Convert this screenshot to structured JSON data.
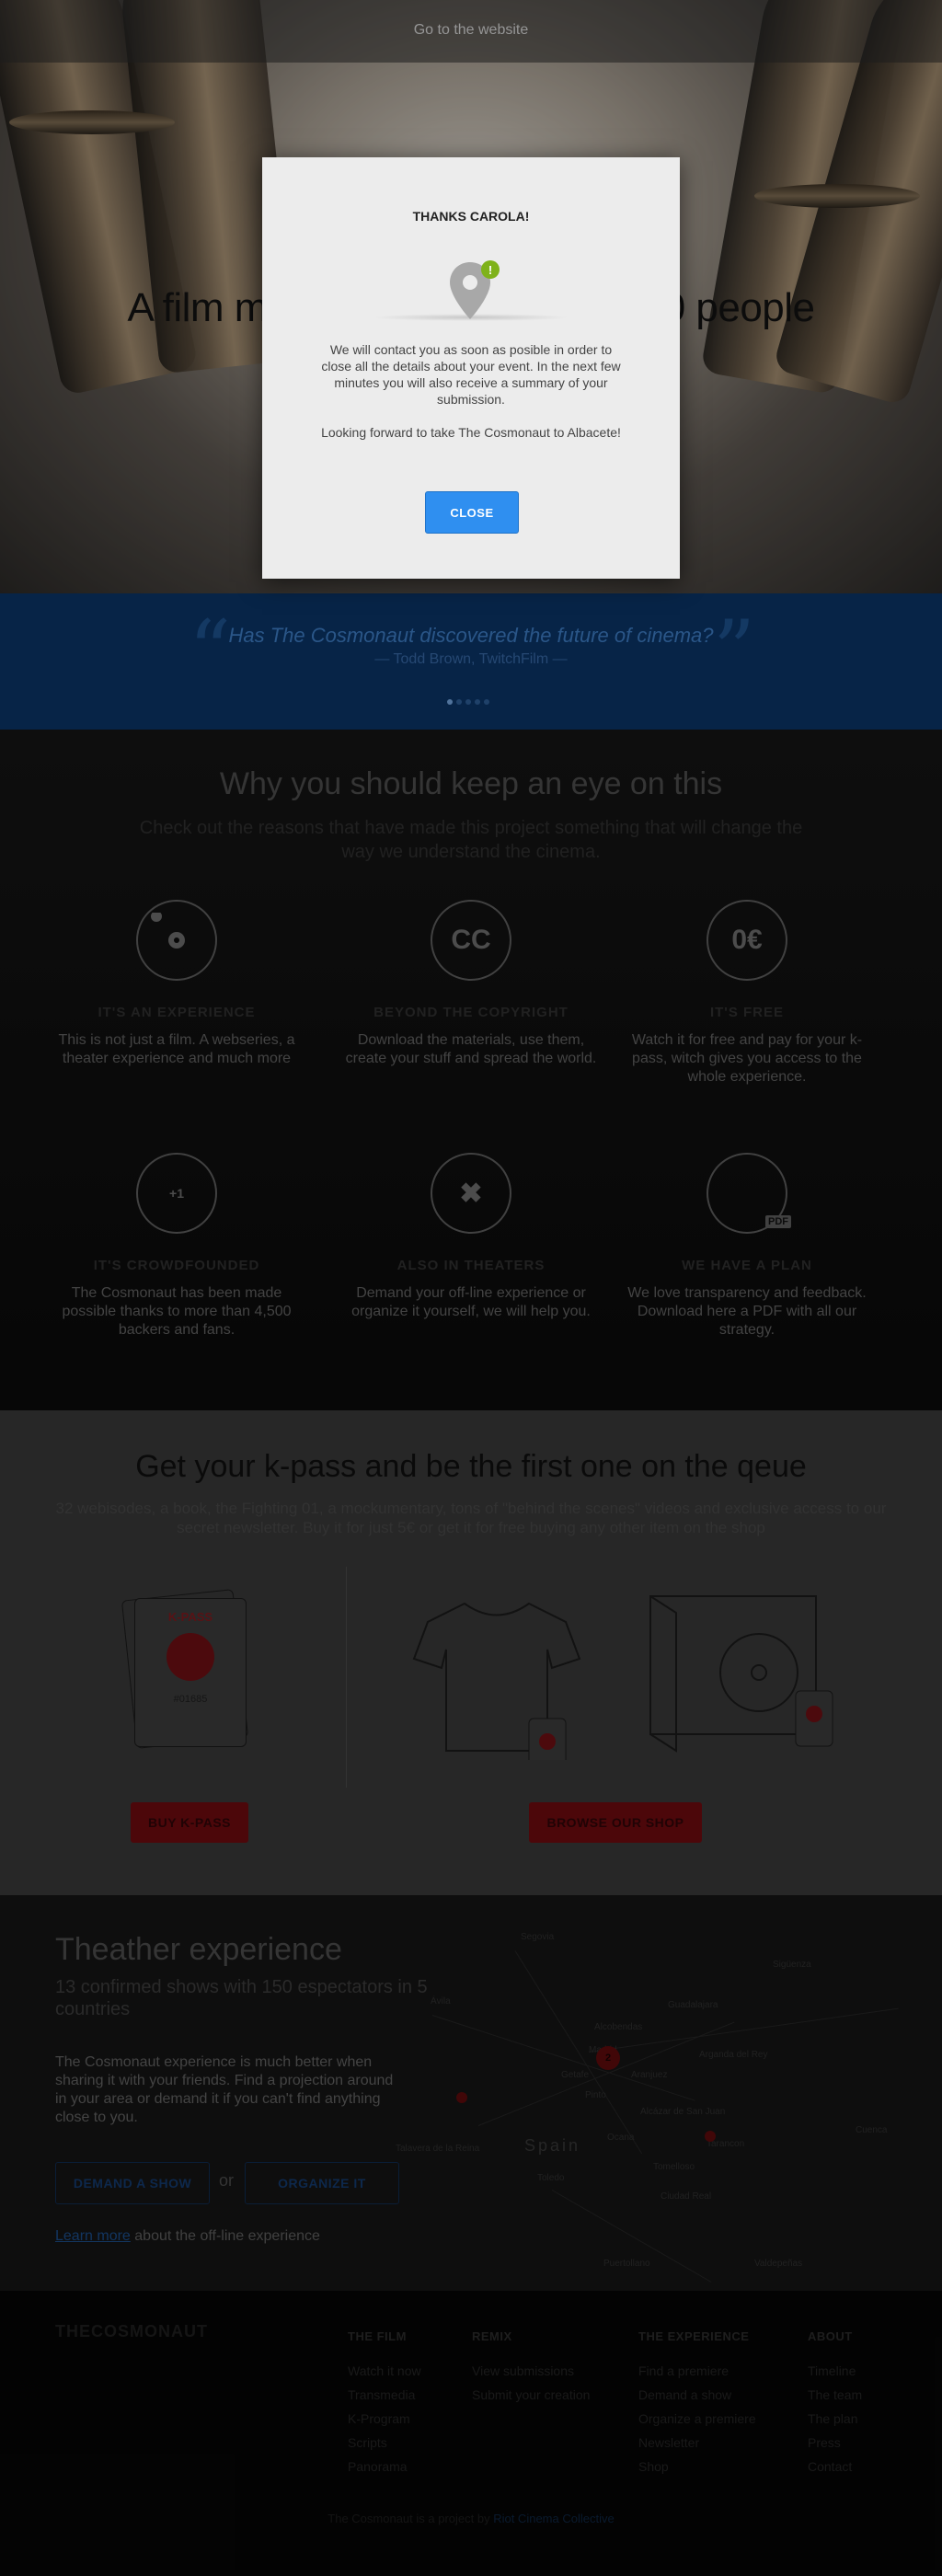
{
  "topbar": {
    "link": "Go to the website"
  },
  "hero": {
    "title": "A film made by more than 4,500 people"
  },
  "quote": {
    "open_mark": "“",
    "close_mark": "”",
    "text": "Has The Cosmonaut discovered the future of cinema?",
    "author": "— Todd Brown, TwitchFilm —",
    "dots_count": 5,
    "active_dot": 1
  },
  "features": {
    "title": "Why you should keep an eye on this",
    "subtitle": "Check out the reasons that have made this project something that will change the way we understand the cinema.",
    "items": [
      {
        "icon": "film-reel-icon",
        "glyph": "◉",
        "title": "IT'S AN EXPERIENCE",
        "desc": "This is not just a film. A webseries, a theater experience and much more"
      },
      {
        "icon": "creative-commons-icon",
        "glyph": "CC",
        "title": "BEYOND THE COPYRIGHT",
        "desc": "Download the materials, use them, create your stuff and spread the world."
      },
      {
        "icon": "zero-euro-icon",
        "glyph": "0€",
        "title": "IT'S FREE",
        "desc": "Watch it for free and pay for your k-pass, witch gives you access to the whole experience."
      },
      {
        "icon": "crowdfunding-bubbles-icon",
        "glyph": "+1",
        "title": "IT'S CROWDFOUNDED",
        "desc": "The Cosmonaut has been made possible thanks to more than 4,500 backers and fans."
      },
      {
        "icon": "spotlights-icon",
        "glyph": "✖",
        "title": "ALSO IN THEATERS",
        "desc": "Demand your off-line experience or organize it yourself, we will help you."
      },
      {
        "icon": "pdf-plan-icon",
        "glyph": "PDF",
        "title": "WE HAVE A PLAN",
        "desc": "We love transparency and feedback. Download here a PDF with all our strategy."
      }
    ]
  },
  "kpass": {
    "title": "Get your k-pass and be the first one on the qeue",
    "subtitle": "32 webisodes, a book, the Fighting 01, a mockumentary, tons of \"behind the scenes\" videos and exclusive access to our secret newsletter. Buy it for just 5€ or get it for free buying any other item on the shop",
    "card_label": "K-PASS",
    "card_number": "#01685",
    "buy_button": "BUY K-PASS",
    "shop_button": "BROWSE OUR SHOP"
  },
  "theater": {
    "title": "Theather experience",
    "stats": "13 confirmed shows with 150 espectators in 5 countries",
    "desc": "The Cosmonaut experience is much better when sharing it with your friends. Find a projection around in your area or demand it if you can't find anything close to you.",
    "demand_button": "DEMAND A SHOW",
    "or": "or",
    "organize_button": "ORGANIZE IT",
    "learn_link": "Learn more",
    "learn_rest": " about the off-line experience",
    "map": {
      "country": "Spain",
      "cities": [
        "Segovia",
        "Ávila",
        "Guadalajara",
        "Madrid",
        "Toledo",
        "Cuenca",
        "Talavera de la Reina",
        "Alcobendas",
        "Getafe",
        "Aranjuez",
        "Ciudad Real",
        "Puertollano",
        "Valdepeñas",
        "Tarancon",
        "Tomelloso",
        "Alcázar de San Juan",
        "Sigüenza",
        "Arganda del Rey",
        "Pinto",
        "Ocana"
      ],
      "cluster_count": "2"
    }
  },
  "footer": {
    "brand": "THECOSMONAUT",
    "columns": [
      {
        "heading": "THE FILM",
        "links": [
          "Watch it now",
          "Transmedia",
          "K-Program",
          "Scripts",
          "Panorama"
        ]
      },
      {
        "heading": "REMIX",
        "links": [
          "View submissions",
          "Submit your creation"
        ]
      },
      {
        "heading": "THE EXPERIENCE",
        "links": [
          "Find a premiere",
          "Demand a show",
          "Organize a premiere",
          "Newsletter",
          "Shop"
        ]
      },
      {
        "heading": "ABOUT",
        "links": [
          "Timeline",
          "The team",
          "The plan",
          "Press",
          "Contact"
        ]
      }
    ],
    "credit_prefix": "The Cosmonaut is a project by ",
    "credit_link": "Riot Cinema Collective"
  },
  "modal": {
    "title": "THANKS CAROLA!",
    "badge": "!",
    "message": "We will contact you as soon as posible in order to close all the details about your event. In the next few minutes you will also receive a summary of your submission.",
    "message2": "Looking forward to take The Cosmonaut to Albacete!",
    "close_button": "CLOSE"
  },
  "colors": {
    "modal_bg": "#ececec",
    "close_button": "#2f8ff0",
    "badge_green": "#7fb21a",
    "quote_blue": "#0b3263",
    "kpass_red": "#c41c24"
  }
}
